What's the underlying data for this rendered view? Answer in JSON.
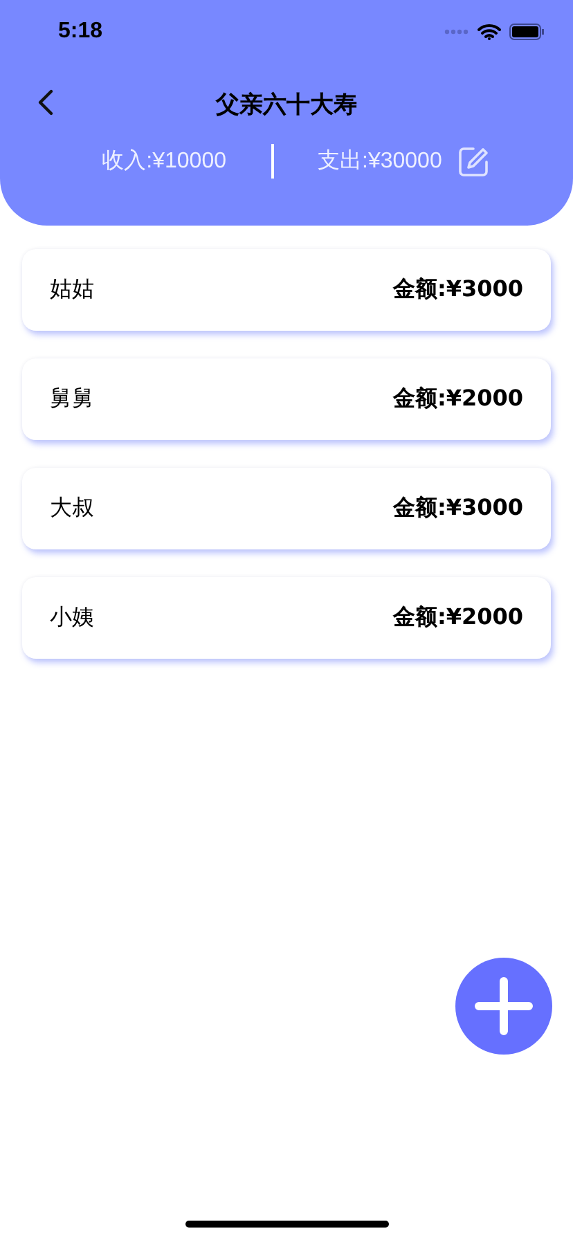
{
  "status_bar": {
    "time": "5:18"
  },
  "header": {
    "title": "父亲六十大寿",
    "income": "收入:¥10000",
    "expense": "支出:¥30000"
  },
  "entries": [
    {
      "name": "姑姑",
      "amount": "金额:¥3000"
    },
    {
      "name": "舅舅",
      "amount": "金额:¥2000"
    },
    {
      "name": "大叔",
      "amount": "金额:¥3000"
    },
    {
      "name": "小姨",
      "amount": "金额:¥2000"
    }
  ]
}
